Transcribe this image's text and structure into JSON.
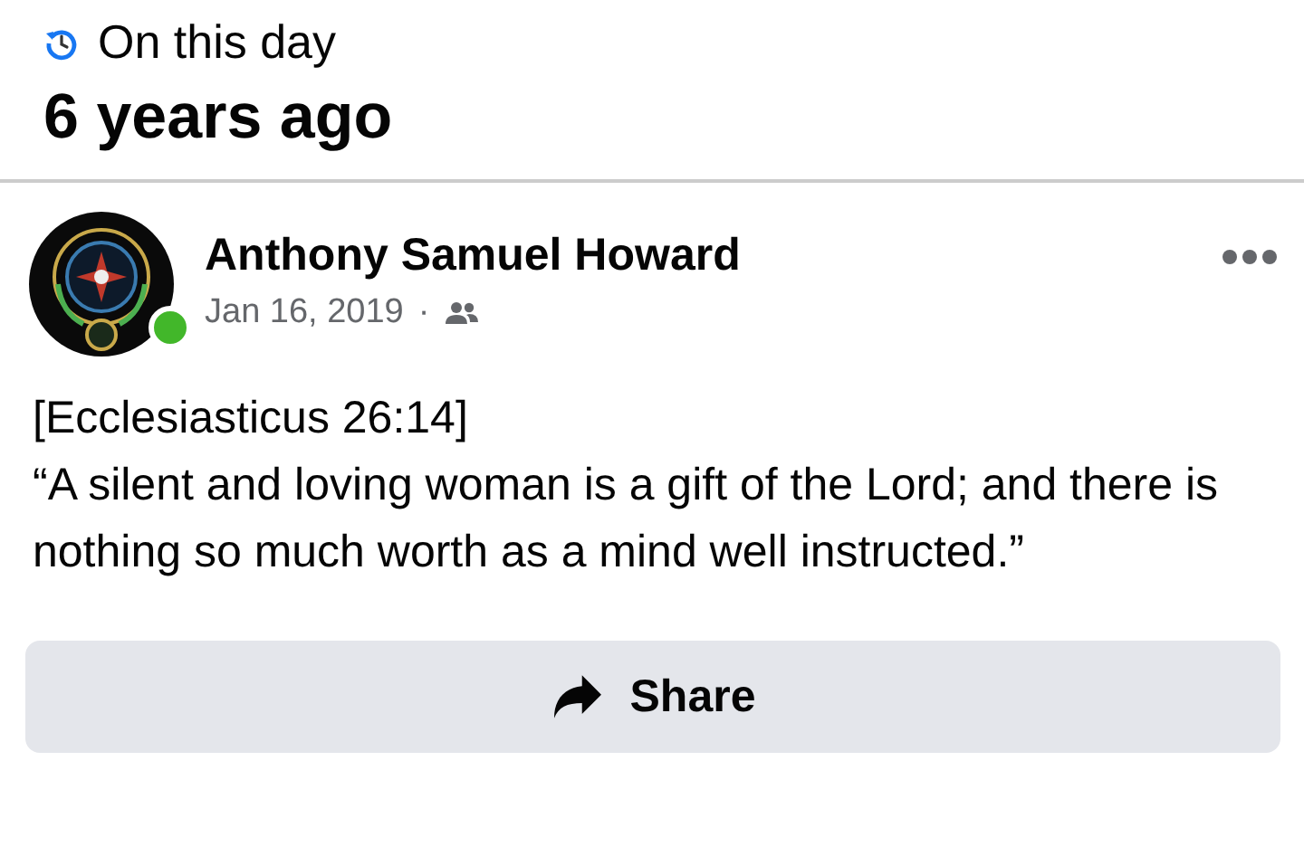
{
  "memory": {
    "label": "On this day",
    "title": "6 years ago"
  },
  "post": {
    "author": "Anthony Samuel Howard",
    "online": true,
    "date": "Jan 16, 2019",
    "separator": "·",
    "text": [
      "[Ecclesiasticus 26:14]",
      "“A silent and loving woman is a gift of the Lord; and there is nothing so much worth as a mind well instructed.”"
    ]
  },
  "share_button": {
    "label": "Share"
  }
}
